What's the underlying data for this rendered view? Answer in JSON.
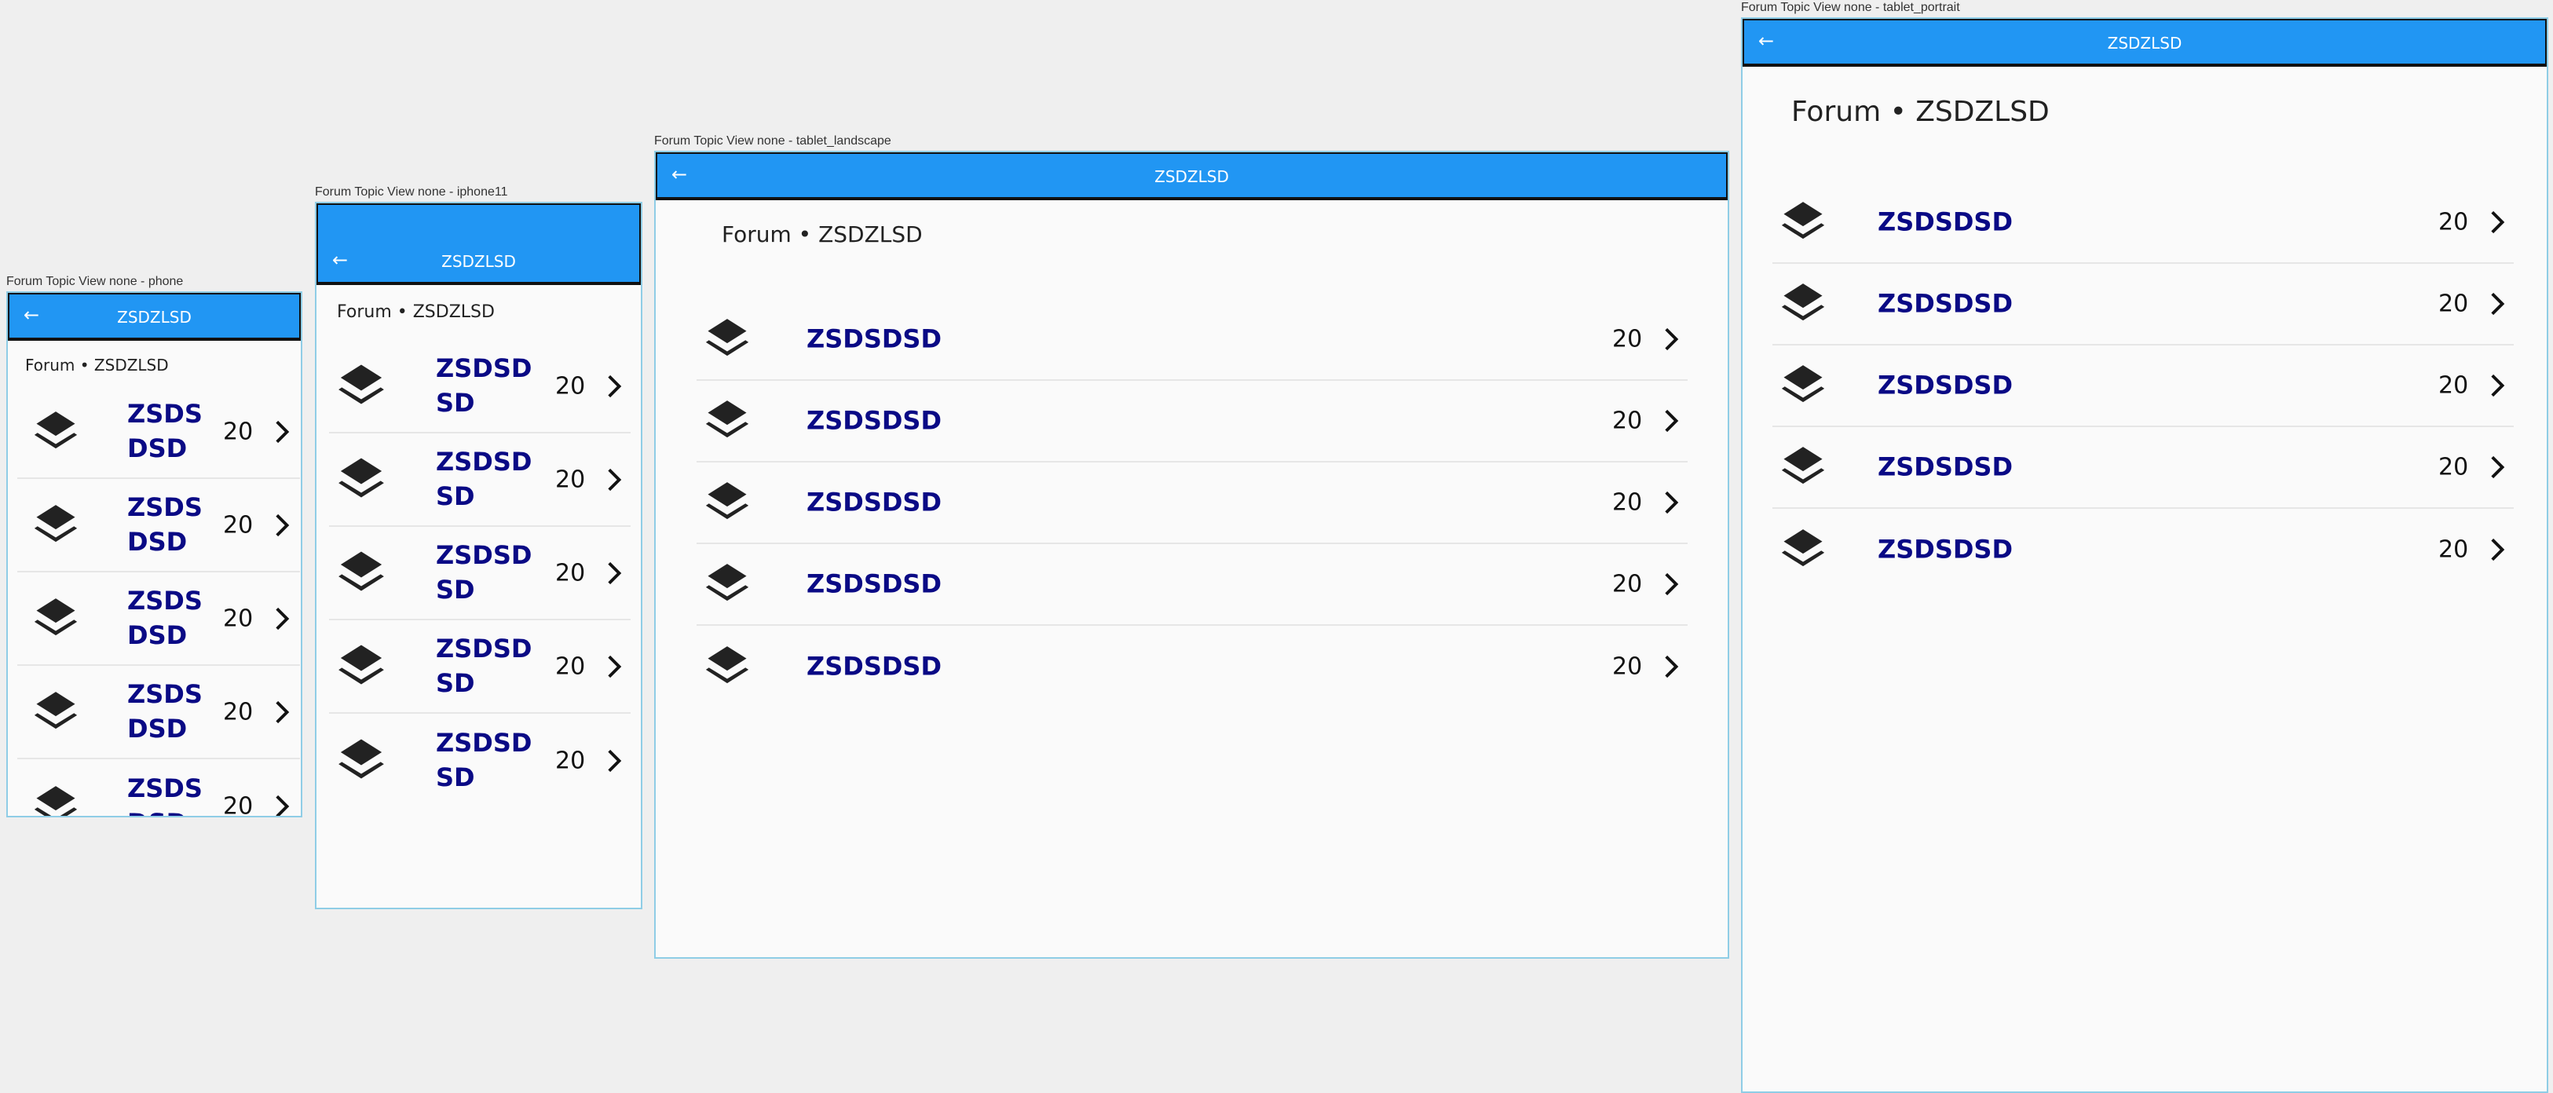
{
  "app_title": "ZSDZLSD",
  "page_heading": "Forum • ZSDZLSD",
  "icons": {
    "back": "arrow-left-icon",
    "row": "layers-icon",
    "row_arrow": "chevron-right-icon"
  },
  "colors": {
    "appbar": "#2196f3",
    "topic_text": "#0a0a85",
    "background": "#fafafa"
  },
  "devices": {
    "phone": {
      "caption": "Forum Topic View none - phone"
    },
    "iphone11": {
      "caption": "Forum Topic View none - iphone11"
    },
    "tablet_landscape": {
      "caption": "Forum Topic View none - tablet_landscape"
    },
    "tablet_portrait": {
      "caption": "Forum Topic View none - tablet_portrait"
    }
  },
  "topics": [
    {
      "name": "ZSDSDSD",
      "count": "20"
    },
    {
      "name": "ZSDSDSD",
      "count": "20"
    },
    {
      "name": "ZSDSDSD",
      "count": "20"
    },
    {
      "name": "ZSDSDSD",
      "count": "20"
    },
    {
      "name": "ZSDSDSD",
      "count": "20"
    }
  ]
}
